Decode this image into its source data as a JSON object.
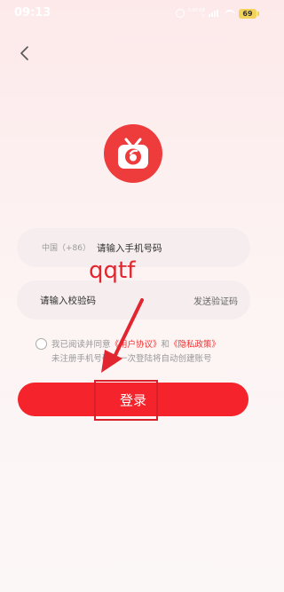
{
  "status_bar": {
    "time": "09:13",
    "network_line1": "0.00 KB",
    "network_line2": "/s",
    "battery": "69",
    "battery_color": "#f3d35a"
  },
  "header": {
    "back_icon": "chevron-left-icon"
  },
  "logo": {
    "icon": "tv-icon",
    "color": "#ee3b3b"
  },
  "phone_field": {
    "country_code": "中国（+86）",
    "placeholder": "请输入手机号码"
  },
  "code_field": {
    "placeholder": "请输入校验码",
    "send_code_label": "发送验证码"
  },
  "agreement": {
    "prefix": "我已阅读并同意",
    "user_agreement": "《用户协议》",
    "and": "和",
    "privacy_policy": "《隐私政策》",
    "note": "未注册手机号码第一次登陆将自动创建账号"
  },
  "login_button": {
    "label": "登录",
    "color": "#f5232b"
  },
  "annotation": {
    "text": "qqtf",
    "color": "#e1262f"
  }
}
